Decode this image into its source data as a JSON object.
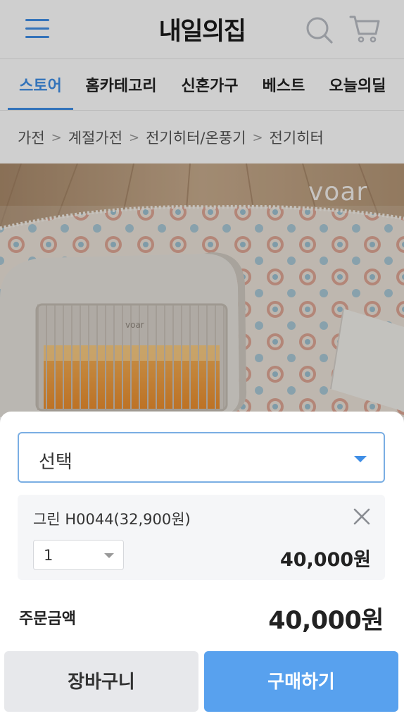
{
  "header": {
    "logo": "내일의집",
    "menu_icon": "hamburger-menu-icon",
    "search_icon": "search-icon",
    "cart_icon": "shopping-cart-icon",
    "accent_color": "#3f8ee6"
  },
  "nav": {
    "tabs": [
      {
        "label": "스토어",
        "active": true
      },
      {
        "label": "홈카테고리",
        "active": false
      },
      {
        "label": "신혼가구",
        "active": false
      },
      {
        "label": "베스트",
        "active": false
      },
      {
        "label": "오늘의딜",
        "active": false
      }
    ]
  },
  "breadcrumb": {
    "items": [
      "가전",
      "계절가전",
      "전기히터/온풍기",
      "전기히터"
    ],
    "separator": ">"
  },
  "product_image": {
    "brand_watermark": "voar",
    "heater_label": "voar"
  },
  "sheet": {
    "option_select": {
      "label": "선택"
    },
    "selected_item": {
      "name": "그린 H0044(32,900원)",
      "quantity": "1",
      "price": "40,000원",
      "remove_icon": "close-icon"
    },
    "total": {
      "label": "주문금액",
      "value": "40,000원"
    },
    "buttons": {
      "cart": "장바구니",
      "buy": "구매하기"
    },
    "colors": {
      "buy_button": "#58a1ee",
      "cart_button": "#e7e8eb",
      "item_background": "#f5f6f8"
    }
  }
}
